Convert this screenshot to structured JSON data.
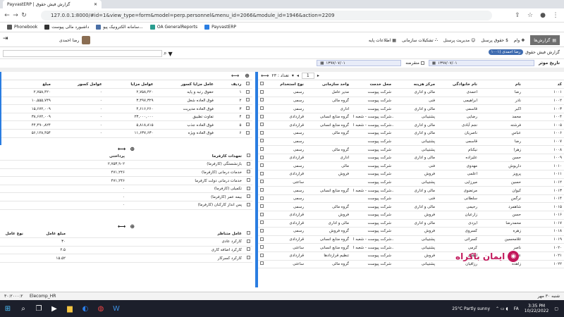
{
  "browser": {
    "tab_title": "PayvastERP | گزارش فیش حقوق",
    "url": "127.0.0.1:8000/#id=1&view_type=form&model=perp.personnel&menu_id=2066&module_id=1946&action=2209",
    "bookmarks": [
      "Phonebook",
      "داشبورد مالی پیوست",
      "سامانه الکترونیک پیو...",
      "OA GeneralReports",
      "PayvastERP"
    ]
  },
  "appbar": {
    "user_name": "رضا احمدی",
    "reports_label": "گزارش‌ها",
    "menus": [
      "اطلاعات پایه",
      "تشکیلات سازمانی",
      "مدیریت پرسنل",
      "حقوق پرسنل",
      "وام"
    ]
  },
  "breadcrumb": {
    "report": "گزارش فیش حقوق",
    "chip": "۱۰۰۱) رضا احمدی"
  },
  "datebar": {
    "label": "تاریخ موثر",
    "date_from": "۱۳۹۷/۰۷/۰۱",
    "date_to": "۱۳۹۷/۰۷/۰۱",
    "expired_label": "منقرضه"
  },
  "right_grid": {
    "pager_count": "تعداد : ۲۳",
    "page_value": "1",
    "columns": [
      "کد",
      "نام",
      "نام خانوادگی",
      "مرکز هزینه",
      "محل خدمت",
      "واحد سازمانی",
      "نوع استخدام"
    ],
    "rows": [
      [
        "۱۰۰۱",
        "رضا",
        "احمدی",
        "مالی و اداری",
        "شرکت پیوست",
        "مدیر عامل",
        "رسمی"
      ],
      [
        "۱۰۰۲",
        "نادر",
        "ابراهیمی",
        "فنی",
        "شرکت پیوست",
        "گروه مالی",
        "رسمی"
      ],
      [
        "۱۰۰۳",
        "اکبر",
        "قاسمی",
        "مالی و اداری",
        "شرکت پیوست",
        "اداری",
        "رسمی"
      ],
      [
        "۱۰۰۴",
        "محمد",
        "رضایی",
        "پشتیبانی",
        "شرکت پیوست - شعبه ا...",
        "گروه منابع انسانی",
        "قراردادی"
      ],
      [
        "۱۰۰۵",
        "فرشته",
        "نجم آبادی",
        "مالی و اداری",
        "شرکت پیوست - شعبه ا...",
        "گروه منابع انسانی",
        "قراردادی"
      ],
      [
        "۱۰۰۶",
        "عباس",
        "ناصریان",
        "مالی و اداری",
        "شرکت پیوست",
        "گروه مالی",
        "رسمی"
      ],
      [
        "۱۰۰۷",
        "رضا",
        "قاسمی",
        "پشتیبانی",
        "شرکت پیوست",
        "",
        "رسمی"
      ],
      [
        "۱۰۰۸",
        "زهرا",
        "نیکنام",
        "پشتیبانی",
        "شرکت پیوست",
        "گروه مالی",
        "رسمی"
      ],
      [
        "۱۰۰۹",
        "حسن",
        "علیزاده",
        "مالی و اداری",
        "شرکت پیوست",
        "اداری",
        "قراردادی"
      ],
      [
        "۱۰۱۰",
        "داریوش",
        "مهدوی",
        "فنی",
        "شرکت پیوست",
        "مالی",
        "رسمی"
      ],
      [
        "۱۰۱۱",
        "پرویز",
        "اعلمی",
        "فروش",
        "شرکت پیوست",
        "فروش",
        "قراردادی"
      ],
      [
        "۱۰۱۲",
        "حسین",
        "میرزایی",
        "پشتیبانی",
        "شرکت پیوست",
        "",
        "ساعتی"
      ],
      [
        "۱۰۱۳",
        "کیوان",
        "مرتضوی",
        "مالی و اداری",
        "شرکت پیوست - شعبه ا...",
        "گروه منابع انسانی",
        "رسمی"
      ],
      [
        "۱۰۱۴",
        "نرگس",
        "سلطانی",
        "فنی",
        "شرکت پیوست",
        "",
        "رسمی"
      ],
      [
        "۱۰۱۵",
        "شاهمرد",
        "رحیمی",
        "مالی و اداری",
        "شرکت پیوست",
        "گروه مالی",
        "رسمی"
      ],
      [
        "۱۰۱۶",
        "حسن",
        "زارعیان",
        "فروش",
        "شرکت پیوست",
        "فروش",
        "قراردادی"
      ],
      [
        "۱۰۱۷",
        "محمدرضا",
        "ایزدی",
        "مالی و اداری",
        "شرکت پیوست",
        "مالی و اداری",
        "قراردادی"
      ],
      [
        "۱۰۱۸",
        "زهره",
        "کسروی",
        "فروش",
        "شرکت پیوست",
        "گروه فروش",
        "رسمی"
      ],
      [
        "۱۰۱۹",
        "غلامحسین",
        "کسرائی",
        "پشتیبانی",
        "شرکت پیوست - شعبه ا...",
        "گروه منابع انسانی",
        "قراردادی"
      ],
      [
        "۱۰۲۰",
        "ناصر",
        "کرمی",
        "پشتیبانی",
        "شرکت پیوست - شعبه ا...",
        "گروه منابع انسانی",
        "ساعتی"
      ],
      [
        "۱۰۲۱",
        "علیرضا",
        "لطفی",
        "فروش",
        "شرکت پیوست",
        "تنظیم قراردادها",
        "قراردادی"
      ],
      [
        "۱۰۲۲",
        "زاهده",
        "رزاقیان",
        "پشتیبانی",
        "شرکت پیوست",
        "گروه مالی",
        "ساعتی"
      ]
    ]
  },
  "left_top": {
    "columns": [
      "ردیف",
      "عامل مزایا کسور",
      "عوامل مزایا",
      "عوامل کسور",
      "مبلغ"
    ],
    "rows": [
      [
        "۱",
        "حقوق رتبه و پایه",
        "۲,۷۵۸,۴۲۰",
        "۰",
        "۲,۷۵۸,۴۲۰"
      ],
      [
        "۲",
        "فوق العاده شغل",
        "۳,۴۹۷,۳۲۹",
        "۰",
        "۱۰,۵۵۵,۷۴۹"
      ],
      [
        "۳",
        "فوق العاده مدیریت",
        "۴,۶۱۶,۲۶۰",
        "۰",
        "۱۵,۶۷۲,۰۰۹"
      ],
      [
        "۴",
        "تفاوت تطبیق",
        "۲۳,۰۰۰,۰۰۰",
        "۰",
        "۳۸,۶۷۲,۰۰۹"
      ],
      [
        "۵",
        "فوق العاده جذب",
        "۵,۸۱۸,۸۱۵",
        "۰",
        "۴۴,۴۹۰,۸۲۴"
      ],
      [
        "۶",
        "فوق العاده ویژه",
        "۱۱,۶۳۷,۶۳۰",
        "۰",
        "۵۶,۱۲۸,۴۵۴"
      ]
    ]
  },
  "left_mid": {
    "columns": [
      "تعهدات کارفرما",
      "پرداختی"
    ],
    "rows": [
      [
        "بازنشستگی (کارفرما)",
        "۲,۷۵۳,۹۰۲"
      ],
      [
        "خدمات درمانی (کارفرما)",
        "۴۷۱,۲۴۶"
      ],
      [
        "خدمات درمانی دولت کارفرما",
        "۴۷۱,۲۴۶"
      ],
      [
        "تکمیلی (کارفرما)",
        "۰"
      ],
      [
        "بیمه عمر (کارفرما)",
        "۰"
      ],
      [
        "پس انداز کارکنان (کارفرما)",
        "۰"
      ]
    ]
  },
  "left_bot": {
    "columns": [
      "عامل متناظر",
      "مبلغ عامل",
      "نوع عامل"
    ],
    "rows": [
      [
        "کارکرد عادی",
        "۳۰",
        ""
      ],
      [
        "کارکرد اضافه کاری",
        "۲.۵",
        ""
      ],
      [
        "کارکرد کسرکار",
        "۱۵.۵۲",
        ""
      ]
    ]
  },
  "status": {
    "left": "۳۰:۲۰۰۰:۲",
    "app": "Elecomp_HR",
    "right": "شنبه ۳۰ مهر"
  },
  "watermark": "ایمان باکراه",
  "taskbar": {
    "weather": "25°C  Partly sunny",
    "lang": "FA",
    "time": "3:35 PM",
    "date": "10/22/2022"
  },
  "colors": {
    "accent": "#2a7de1",
    "appbar_btn": "#6e6e6e",
    "chip": "#3f6cb0",
    "taskbar": "#1c1f2b"
  }
}
